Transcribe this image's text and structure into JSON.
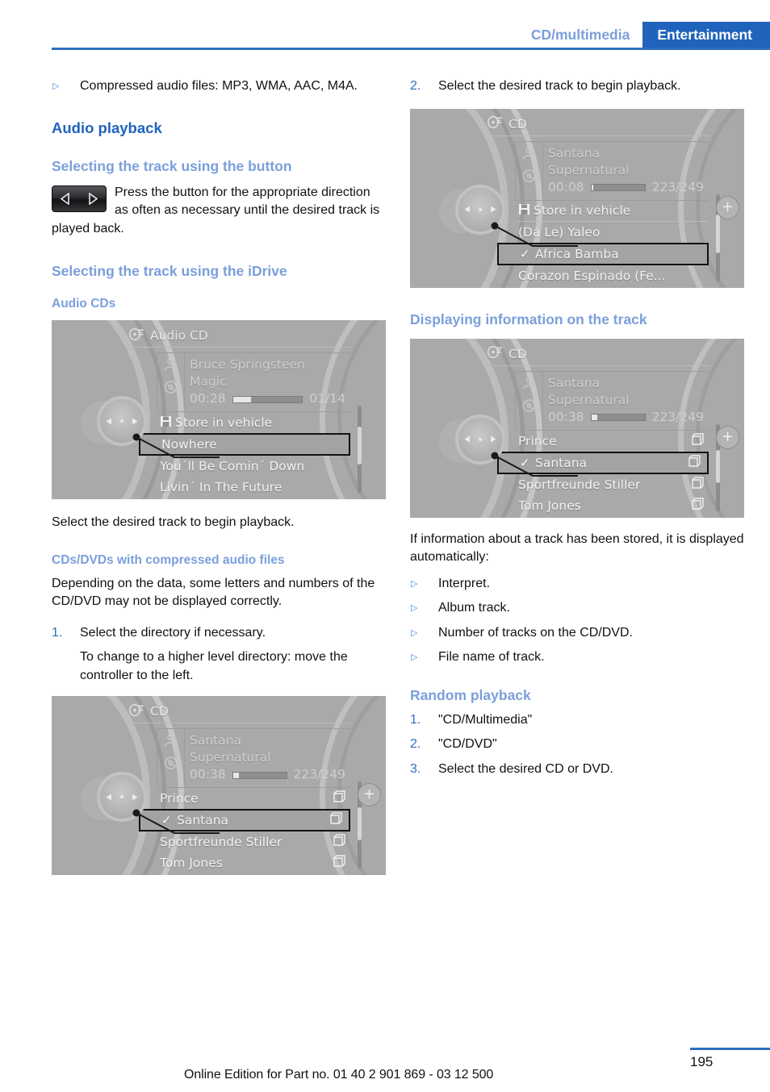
{
  "header": {
    "tab_inactive": "CD/multimedia",
    "tab_active": "Entertainment",
    "accent_color": "#1f63bd",
    "muted_accent_color": "#7b9fdb"
  },
  "left_column": {
    "intro_bullet": {
      "marker": "▷",
      "text": "Compressed audio files: MP3, WMA, AAC, M4A."
    },
    "section_title": "Audio playback",
    "sub1_title": "Selecting the track using the button",
    "sub1_body": "Press the button for the appropriate direction as often as necessary until the desired track is played back.",
    "skip_button": {
      "prev_icon": "triangle-left-icon",
      "next_icon": "triangle-right-icon"
    },
    "sub2_title": "Selecting the track using the iDrive",
    "sub2_heading": "Audio CDs",
    "after_image_1": "Select the desired track to begin playback.",
    "sub3_heading": "CDs/DVDs with compressed audio files",
    "sub3_body": "Depending on the data, some letters and numbers of the CD/DVD may not be displayed correctly.",
    "step1": {
      "num": "1.",
      "text": "Select the directory if necessary."
    },
    "step1_sub": "To change to a higher level directory: move the controller to the left."
  },
  "right_column": {
    "step2": {
      "num": "2.",
      "text": "Select the desired track to begin playback."
    },
    "sub1_title": "Displaying information on the track",
    "info_intro": "If information about a track has been stored, it is displayed automatically:",
    "info_bullets": [
      {
        "marker": "▷",
        "text": "Interpret."
      },
      {
        "marker": "▷",
        "text": "Album track."
      },
      {
        "marker": "▷",
        "text": "Number of tracks on the CD/DVD."
      },
      {
        "marker": "▷",
        "text": "File name of track."
      }
    ],
    "random_title": "Random playback",
    "random_steps": [
      {
        "num": "1.",
        "text": "\"CD/Multimedia\""
      },
      {
        "num": "2.",
        "text": "\"CD/DVD\""
      },
      {
        "num": "3.",
        "text": "Select the desired CD or DVD."
      }
    ]
  },
  "screens": {
    "audio_cd": {
      "title": "Audio CD",
      "title_icon": "cd-music-icon",
      "artist_icon": "person-icon",
      "album_icon": "disc-icon",
      "artist": "Bruce Springsteen",
      "album": "Magic",
      "elapsed": "00:28",
      "counter": "01/14",
      "progress_percent": 26,
      "items": [
        {
          "label": "Store in vehicle",
          "icon": "floppy-disk-icon",
          "selected": false,
          "checked": false,
          "separator": false
        },
        {
          "label": "Nowhere",
          "icon": "",
          "selected": true,
          "checked": false,
          "separator": false
        },
        {
          "label": "You´ll Be Comin´ Down",
          "icon": "",
          "selected": false,
          "checked": false,
          "separator": false
        },
        {
          "label": "Livin´ In The Future",
          "icon": "",
          "selected": false,
          "checked": false,
          "separator": false
        }
      ],
      "plus_button": false,
      "scroll_top_percent": 24,
      "scroll_height_percent": 44
    },
    "cd_folders_left": {
      "title": "CD",
      "title_icon": "cd-music-icon",
      "artist_icon": "person-icon",
      "album_icon": "disc-icon",
      "artist": "Santana",
      "album": "Supernatural",
      "elapsed": "00:38",
      "counter": "223/249",
      "progress_percent": 11,
      "items": [
        {
          "label": "Prince",
          "icon": "folder-icon",
          "selected": false,
          "checked": false,
          "separator": false
        },
        {
          "label": "Santana",
          "icon": "folder-icon",
          "selected": true,
          "checked": true,
          "separator": false
        },
        {
          "label": "Sportfreunde Stiller",
          "icon": "folder-icon",
          "selected": false,
          "checked": false,
          "separator": false
        },
        {
          "label": "Tom Jones",
          "icon": "folder-icon",
          "selected": false,
          "checked": false,
          "separator": false
        }
      ],
      "plus_button": true,
      "plus_icon": "plus-icon",
      "scroll_top_percent": 30,
      "scroll_height_percent": 38
    },
    "cd_tracks_right": {
      "title": "CD",
      "title_icon": "cd-music-icon",
      "artist_icon": "person-icon",
      "album_icon": "disc-icon",
      "artist": "Santana",
      "album": "Supernatural",
      "elapsed": "00:08",
      "counter": "223/249",
      "progress_percent": 4,
      "items": [
        {
          "label": "Store in vehicle",
          "icon": "floppy-disk-icon",
          "selected": false,
          "checked": false,
          "separator": true
        },
        {
          "label": "(Da Le) Yaleo",
          "icon": "",
          "selected": false,
          "checked": false,
          "separator": false
        },
        {
          "label": "Africa Bamba",
          "icon": "",
          "selected": true,
          "checked": true,
          "separator": false
        },
        {
          "label": "Corazon Espinado (Fe...",
          "icon": "",
          "selected": false,
          "checked": false,
          "separator": false
        }
      ],
      "plus_button": true,
      "plus_icon": "plus-icon",
      "scroll_top_percent": 24,
      "scroll_height_percent": 44
    },
    "cd_folders_right": {
      "title": "CD",
      "title_icon": "cd-music-icon",
      "artist_icon": "person-icon",
      "album_icon": "disc-icon",
      "artist": "Santana",
      "album": "Supernatural",
      "elapsed": "00:38",
      "counter": "223/249",
      "progress_percent": 11,
      "items": [
        {
          "label": "Prince",
          "icon": "folder-icon",
          "selected": false,
          "checked": false,
          "separator": false
        },
        {
          "label": "Santana",
          "icon": "folder-icon",
          "selected": true,
          "checked": true,
          "separator": false
        },
        {
          "label": "Sportfreunde Stiller",
          "icon": "folder-icon",
          "selected": false,
          "checked": false,
          "separator": false
        },
        {
          "label": "Tom Jones",
          "icon": "folder-icon",
          "selected": false,
          "checked": false,
          "separator": false
        }
      ],
      "plus_button": true,
      "plus_icon": "plus-icon",
      "scroll_top_percent": 30,
      "scroll_height_percent": 38
    }
  },
  "footer": {
    "text": "Online Edition for Part no. 01 40 2 901 869 - 03 12 500",
    "page_number": "195"
  }
}
